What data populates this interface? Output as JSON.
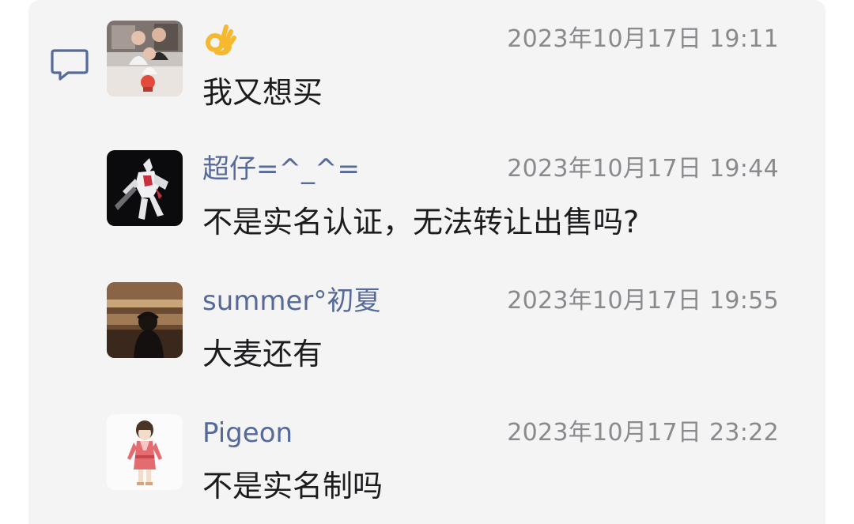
{
  "comments": [
    {
      "author": "👌",
      "author_is_emoji": true,
      "timestamp": "2023年10月17日 19:11",
      "text": "我又想买",
      "avatar_icon": "family-photo-avatar"
    },
    {
      "author": "超仔=^_^=",
      "timestamp": "2023年10月17日 19:44",
      "text": "不是实名认证，无法转让出售吗?",
      "avatar_icon": "robot-figure-avatar"
    },
    {
      "author": "summer°初夏",
      "timestamp": "2023年10月17日 19:55",
      "text": "大麦还有",
      "avatar_icon": "concert-silhouette-avatar"
    },
    {
      "author": "Pigeon",
      "timestamp": "2023年10月17日 23:22",
      "text": "不是实名制吗",
      "avatar_icon": "anime-girl-avatar"
    }
  ],
  "colors": {
    "author_name": "#566a99",
    "timestamp": "#8a8a8e",
    "text": "#1c1c1e",
    "panel_bg": "#f4f4f5",
    "comment_icon": "#566a99"
  }
}
